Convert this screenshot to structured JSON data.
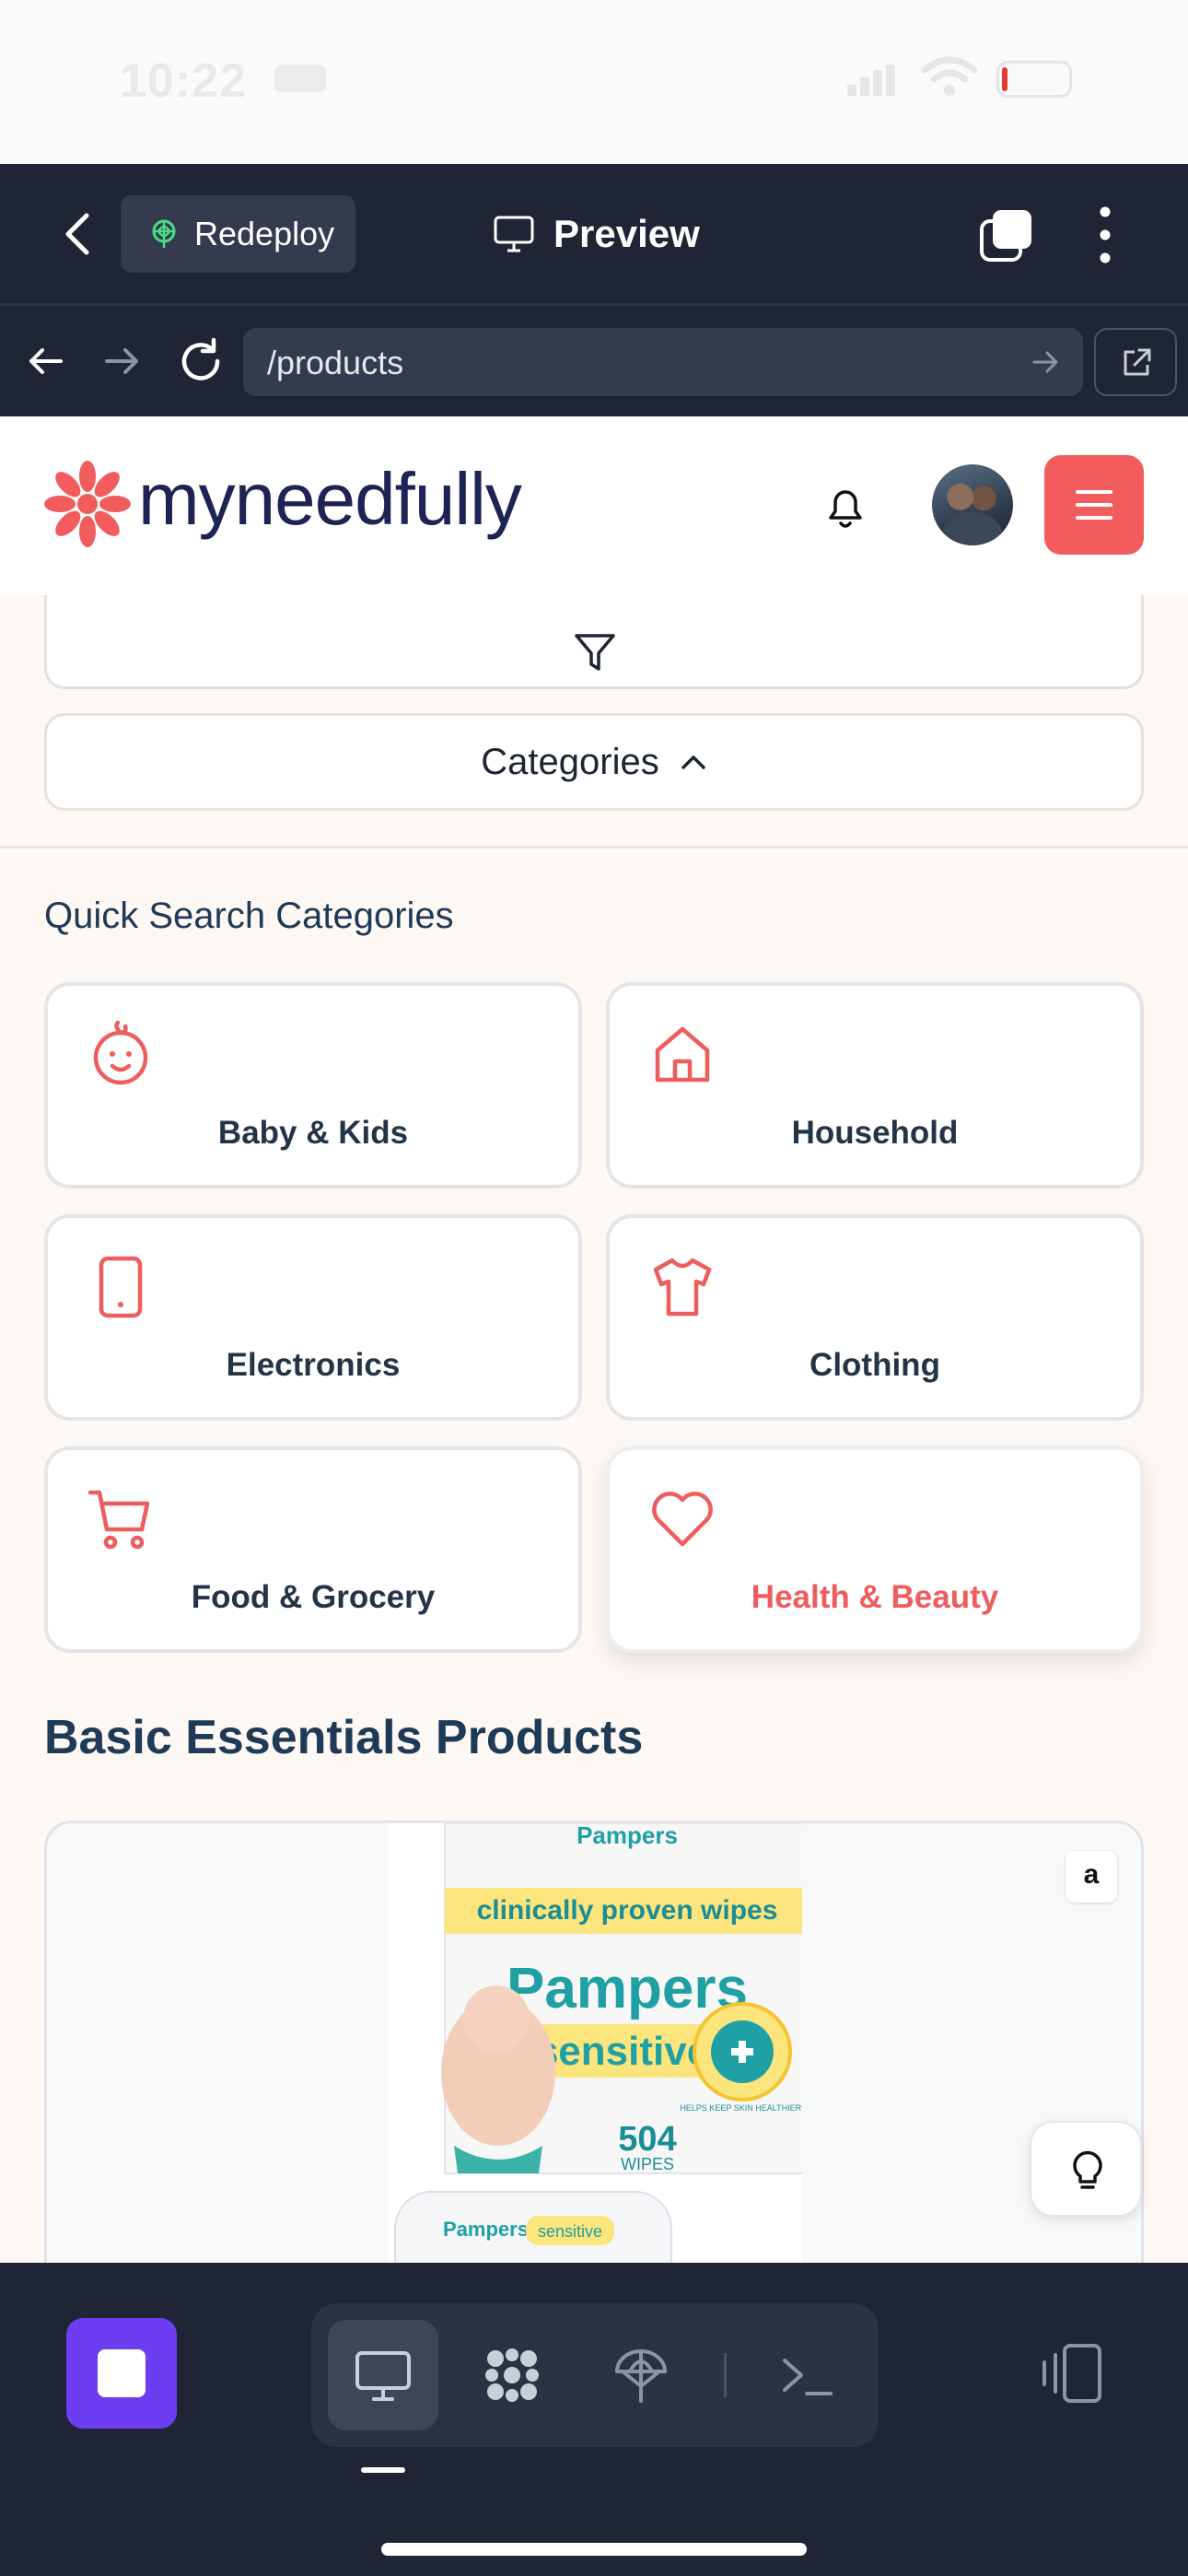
{
  "status_bar": {
    "time": "10:22"
  },
  "app_header": {
    "redeploy_label": "Redeploy",
    "title": "Preview"
  },
  "browser": {
    "url": "/products"
  },
  "site": {
    "brand": "myneedfully",
    "brand_color": "#f25c5c",
    "brand_text_color": "#1d2455"
  },
  "filters": {
    "categories_label": "Categories"
  },
  "quick_search": {
    "title": "Quick Search Categories",
    "categories": [
      {
        "label": "Baby & Kids",
        "icon": "baby-face-icon",
        "active": false
      },
      {
        "label": "Household",
        "icon": "house-icon",
        "active": false
      },
      {
        "label": "Electronics",
        "icon": "tablet-icon",
        "active": false
      },
      {
        "label": "Clothing",
        "icon": "shirt-icon",
        "active": false
      },
      {
        "label": "Food & Grocery",
        "icon": "shopping-cart-icon",
        "active": false
      },
      {
        "label": "Health & Beauty",
        "icon": "heart-icon",
        "active": true
      }
    ]
  },
  "products": {
    "title": "Basic Essentials Products",
    "items": [
      {
        "retailer_badge": "a",
        "image_alt_brand": "Pampers",
        "image_text": {
          "top_brand": "Pampers",
          "banner": "clinically proven wipes",
          "brand": "Pampers",
          "variant": "sensitive",
          "seal": "HELPS KEEP SKIN HEALTHIER*",
          "count": "504",
          "count_unit": "WIPES",
          "pack_brand": "Pampers",
          "pack_variant": "sensitive"
        }
      }
    ]
  },
  "toolbar": {
    "tools": [
      "desktop-icon",
      "apps-grid-icon",
      "deploy-icon",
      "terminal-icon"
    ]
  }
}
